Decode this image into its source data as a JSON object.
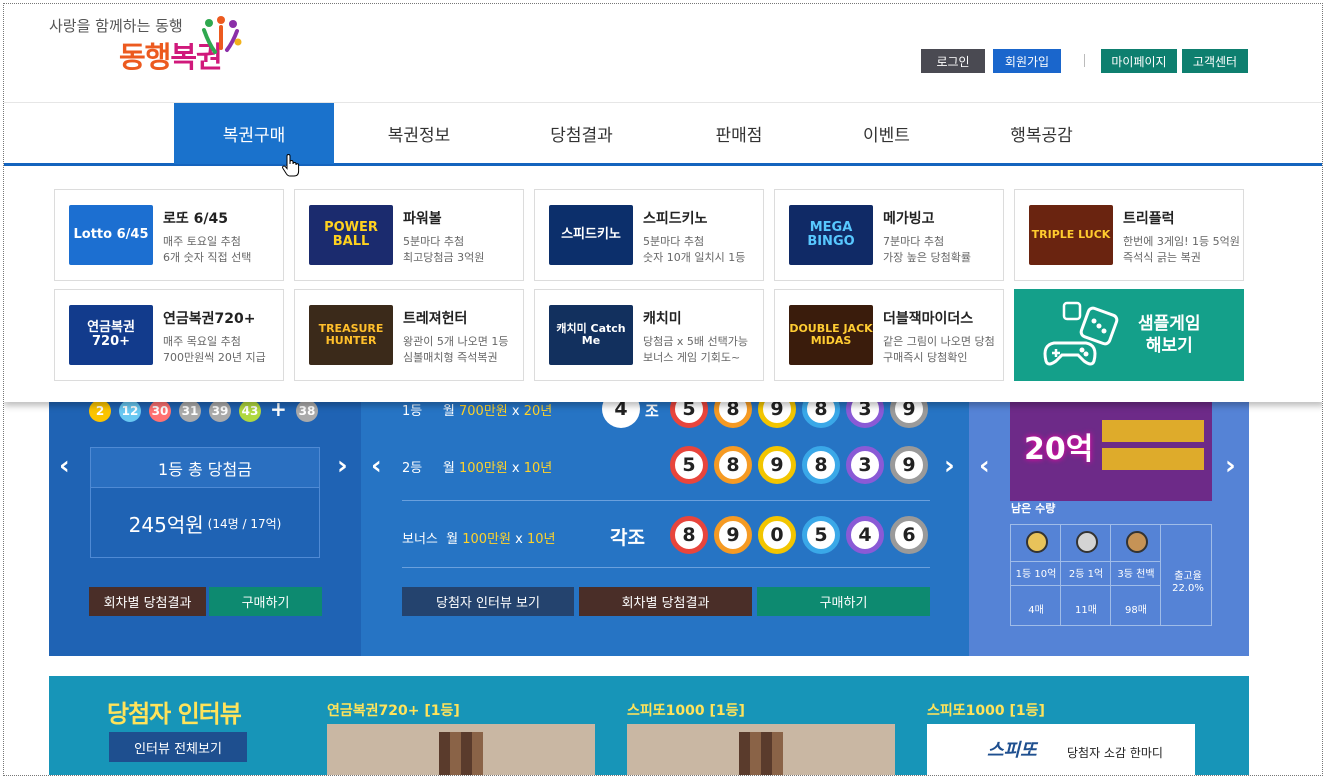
{
  "header": {
    "slogan": "사랑을 함께하는 동행",
    "logo_part1": "동행",
    "logo_part2": "복권",
    "buttons": [
      {
        "label": "로그인",
        "color": "#4a4a52"
      },
      {
        "label": "회원가입",
        "color": "#1a66cc"
      },
      {
        "label": "마이페이지",
        "color": "#0e7f6f"
      },
      {
        "label": "고객센터",
        "color": "#0e7f6f"
      }
    ]
  },
  "nav": {
    "items": [
      "복권구매",
      "복권정보",
      "당첨결과",
      "판매점",
      "이벤트",
      "행복공감"
    ],
    "active_index": 0
  },
  "mega_menu": {
    "games": [
      {
        "name": "로또 6/45",
        "desc1": "매주 토요일 추첨",
        "desc2": "6개 숫자 직접 선택",
        "thumb": "Lotto 6/45",
        "thumb_bg": "#1c6fd1",
        "thumb_fg": "#ffffff"
      },
      {
        "name": "파워볼",
        "desc1": "5분마다 추첨",
        "desc2": "최고당첨금 3억원",
        "thumb": "POWER BALL",
        "thumb_bg": "#1b2b6e",
        "thumb_fg": "#ffd21f"
      },
      {
        "name": "스피드키노",
        "desc1": "5분마다 추첨",
        "desc2": "숫자 10개 일치시 1등",
        "thumb": "스피드키노",
        "thumb_bg": "#0c2f6b",
        "thumb_fg": "#ffffff"
      },
      {
        "name": "메가빙고",
        "desc1": "7분마다 추첨",
        "desc2": "가장 높은 당첨확률",
        "thumb": "MEGA BINGO",
        "thumb_bg": "#102a66",
        "thumb_fg": "#58c8ff"
      },
      {
        "name": "트리플럭",
        "desc1": "한번에 3게임! 1등 5억원",
        "desc2": "즉석식 긁는 복권",
        "thumb": "TRIPLE LUCK",
        "thumb_bg": "#6a2410",
        "thumb_fg": "#ffcb2e"
      },
      {
        "name": "연금복권720+",
        "desc1": "매주 목요일 추첨",
        "desc2": "700만원씩 20년 지급",
        "thumb": "연금복권720+",
        "thumb_bg": "#123b8c",
        "thumb_fg": "#ffffff"
      },
      {
        "name": "트레져헌터",
        "desc1": "왕관이 5개 나오면 1등",
        "desc2": "심볼매치형 즉석복권",
        "thumb": "TREASURE HUNTER",
        "thumb_bg": "#3b2a1a",
        "thumb_fg": "#ffbf2b"
      },
      {
        "name": "캐치미",
        "desc1": "당첨금 x 5배 선택가능",
        "desc2": "보너스 게임 기회도~",
        "thumb": "캐치미 Catch Me",
        "thumb_bg": "#12305e",
        "thumb_fg": "#ffffff"
      },
      {
        "name": "더블잭마이더스",
        "desc1": "같은 그림이 나오면 당첨",
        "desc2": "구매즉시 당첨확인",
        "thumb": "DOUBLE JACK MIDAS",
        "thumb_bg": "#3a1c0c",
        "thumb_fg": "#ffcc33"
      }
    ],
    "sample": {
      "line1": "샘플게임",
      "line2": "해보기",
      "color": "#14a08a"
    }
  },
  "lotto_panel": {
    "numbers": [
      "2",
      "12",
      "30",
      "31",
      "39",
      "43"
    ],
    "plus": "+",
    "bonus": "38",
    "ball_colors": [
      "#fbc400",
      "#69c8f2",
      "#ff7272",
      "#aaaaaa",
      "#aaaaaa",
      "#b0d840"
    ],
    "bonus_color": "#aaaaaa",
    "total_label": "1등 총 당첨금",
    "total_amount": "245억원",
    "total_winners": "(14명 / 17억)",
    "btn_results": "회차별 당첨결과",
    "btn_buy": "구매하기"
  },
  "pension_panel": {
    "rows": [
      {
        "rank": "1등",
        "month": "월",
        "amount": "700만원",
        "x": "x",
        "years": "20년"
      },
      {
        "rank": "2등",
        "month": "월",
        "amount": "100만원",
        "x": "x",
        "years": "10년"
      },
      {
        "rank": "보너스",
        "month": "월",
        "amount": "100만원",
        "x": "x",
        "years": "10년"
      }
    ],
    "group": "4",
    "group_suffix": "조",
    "each_group": "각조",
    "first_numbers": [
      "5",
      "8",
      "9",
      "8",
      "3",
      "9"
    ],
    "second_numbers": [
      "5",
      "8",
      "9",
      "8",
      "3",
      "9"
    ],
    "bonus_numbers": [
      "8",
      "9",
      "0",
      "5",
      "4",
      "6"
    ],
    "ring_colors": [
      "#e8453c",
      "#f59a23",
      "#f2c500",
      "#3aa8e8",
      "#8a5ad6",
      "#9a9a9a"
    ],
    "btn_interview": "당첨자 인터뷰 보기",
    "btn_results": "회차별 당첨결과",
    "btn_buy": "구매하기"
  },
  "instant_panel": {
    "countdown": "20억",
    "stock_label": "남은 수량",
    "tiers": [
      {
        "medal": "1등",
        "label": "1등 10억",
        "count": "4매"
      },
      {
        "medal": "2등",
        "label": "2등 1억",
        "count": "11매"
      },
      {
        "medal": "3등",
        "label": "3등 천백",
        "count": "98매"
      }
    ],
    "sales_label": "출고율",
    "sales_value": "22.0%"
  },
  "interview": {
    "title": "당첨자 인터뷰",
    "view_all": "인터뷰 전체보기",
    "cards": [
      "연금복권720+ [1등]",
      "스피또1000 [1등]",
      "스피또1000 [1등]"
    ],
    "speetto_caption": "당첨자 소감 한마디",
    "speetto_logo": "스피또"
  }
}
